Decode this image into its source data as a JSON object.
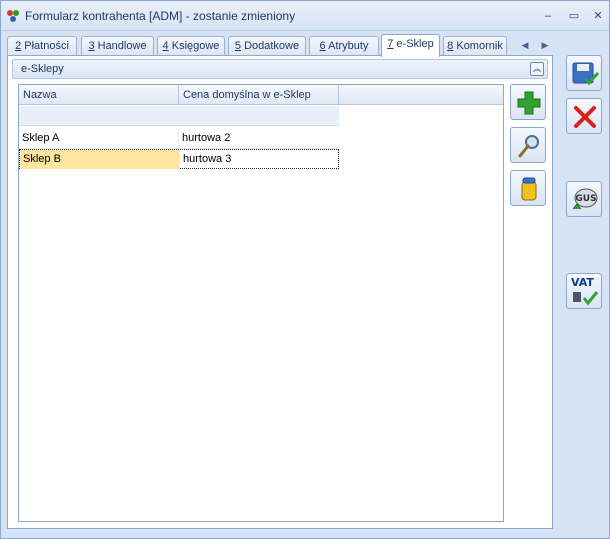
{
  "window": {
    "title": "Formularz kontrahenta [ADM] - zostanie zmieniony",
    "minimize": "–",
    "maximize": "▭",
    "close": "✕"
  },
  "tabs": [
    {
      "key": "2",
      "label": " Płatności"
    },
    {
      "key": "3",
      "label": " Handlowe"
    },
    {
      "key": "4",
      "label": " Księgowe"
    },
    {
      "key": "5",
      "label": " Dodatkowe"
    },
    {
      "key": "6",
      "label": " Atrybuty"
    },
    {
      "key": "7",
      "label": " e-Sklep",
      "active": true
    },
    {
      "key": "8",
      "label": " Komornik"
    }
  ],
  "tab_scroll": {
    "left": "◀",
    "right": "▶"
  },
  "section": {
    "title": "e-Sklepy",
    "collapse": "︽"
  },
  "grid": {
    "columns": [
      "Nazwa",
      "Cena domyślna w e-Sklep"
    ],
    "rows": [
      {
        "name": "Sklep A",
        "price": "hurtowa 2",
        "selected": false
      },
      {
        "name": "Sklep B",
        "price": "hurtowa 3",
        "selected": true
      }
    ]
  },
  "buttons": {
    "add": "add-icon",
    "edit": "magnifier-icon",
    "delete": "trash-icon",
    "save": "save-icon",
    "cancel": "cancel-icon",
    "gus": "GUS",
    "vat": "VAT"
  },
  "colors": {
    "accent": "#1e3966",
    "selection": "#fde49f",
    "add": "#2fa52f",
    "cancel": "#d8201e"
  }
}
